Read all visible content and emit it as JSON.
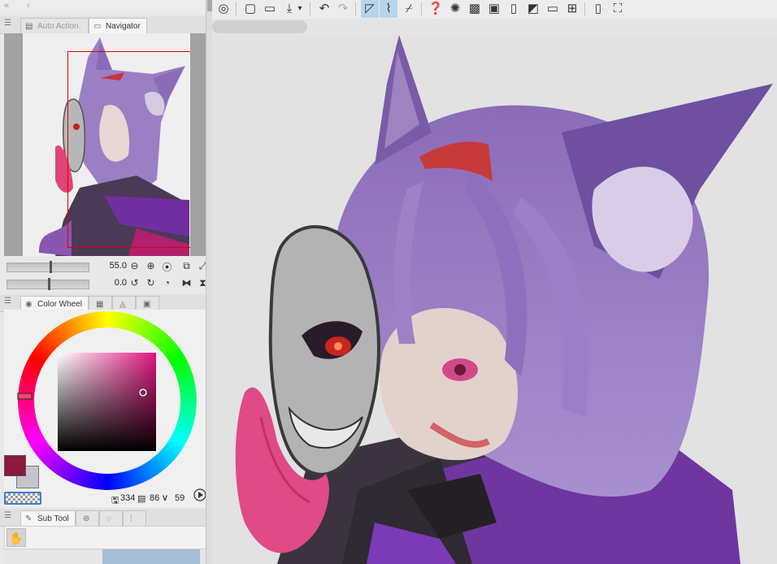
{
  "panels": {
    "top_strip": {
      "collapse_glyph": "«",
      "back_glyph": "‹"
    },
    "tabs_top": [
      {
        "label": "Auto Action",
        "icon": "auto-action-icon",
        "active": false
      },
      {
        "label": "Navigator",
        "icon": "navigator-icon",
        "active": true
      }
    ],
    "navigator": {
      "zoom_value": "55.0",
      "rotation_value": "0.0"
    },
    "tabs_color": [
      {
        "label": "Color Wheel",
        "icon": "color-wheel-icon",
        "active": true
      },
      {
        "label": "",
        "icon": "color-set-icon",
        "active": false
      },
      {
        "label": "",
        "icon": "intermediate-color-icon",
        "active": false
      },
      {
        "label": "",
        "icon": "approximate-color-icon",
        "active": false
      }
    ],
    "color": {
      "main": "#8b1a3c",
      "sub": "#c6c4cb",
      "h": "334",
      "s": "86",
      "v": "59"
    },
    "tabs_subtool": [
      {
        "label": "Sub Tool",
        "icon": "sub-tool-icon",
        "active": true
      }
    ]
  },
  "toolbar": {
    "icons": [
      "logo-icon",
      "new-file-icon",
      "open-file-icon",
      "save-icon",
      "save-menu-chevron-icon",
      "undo-icon",
      "redo-icon",
      "selection-outline-icon",
      "erase-outside-icon",
      "clear-icon",
      "magic-wand-icon",
      "show-area-icon",
      "transparency-icon",
      "border-icon",
      "fill-icon",
      "canvas-icon",
      "grid-icon",
      "smartphone-icon",
      "transform-icon"
    ]
  }
}
